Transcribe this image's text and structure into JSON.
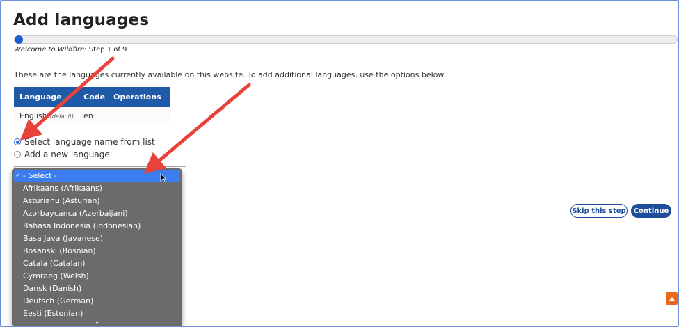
{
  "page": {
    "title": "Add languages",
    "progress_fraction": 0.111,
    "step_italic": "Welcome to Wildfire",
    "step_rest": ": Step 1 of 9",
    "intro": "These are the languages currently available on this website. To add additional languages, use the options below."
  },
  "table": {
    "headers": [
      "Language",
      "Code",
      "Operations"
    ],
    "rows": [
      {
        "language": "English",
        "tag": "(default)",
        "code": "en"
      }
    ]
  },
  "options": {
    "select_from_list": "Select language name from list",
    "add_new": "Add a new language"
  },
  "dropdown": {
    "selected": "- Select -",
    "check": "✓",
    "items": [
      "Afrikaans (Afrikaans)",
      "Asturianu (Asturian)",
      "Azərbaycanca (Azerbaijani)",
      "Bahasa Indonesia (Indonesian)",
      "Basa Java (Javanese)",
      "Bosanski (Bosnian)",
      "Català (Catalan)",
      "Cymraeg (Welsh)",
      "Dansk (Danish)",
      "Deutsch (German)",
      "Eesti (Estonian)"
    ]
  },
  "buttons": {
    "skip": "Skip this step",
    "continue": "Continue"
  },
  "colors": {
    "accent": "#1f4d9a",
    "table_header": "#1f5aa8",
    "annotation_arrow": "#e8433a",
    "scroll_top": "#e86a1a"
  }
}
